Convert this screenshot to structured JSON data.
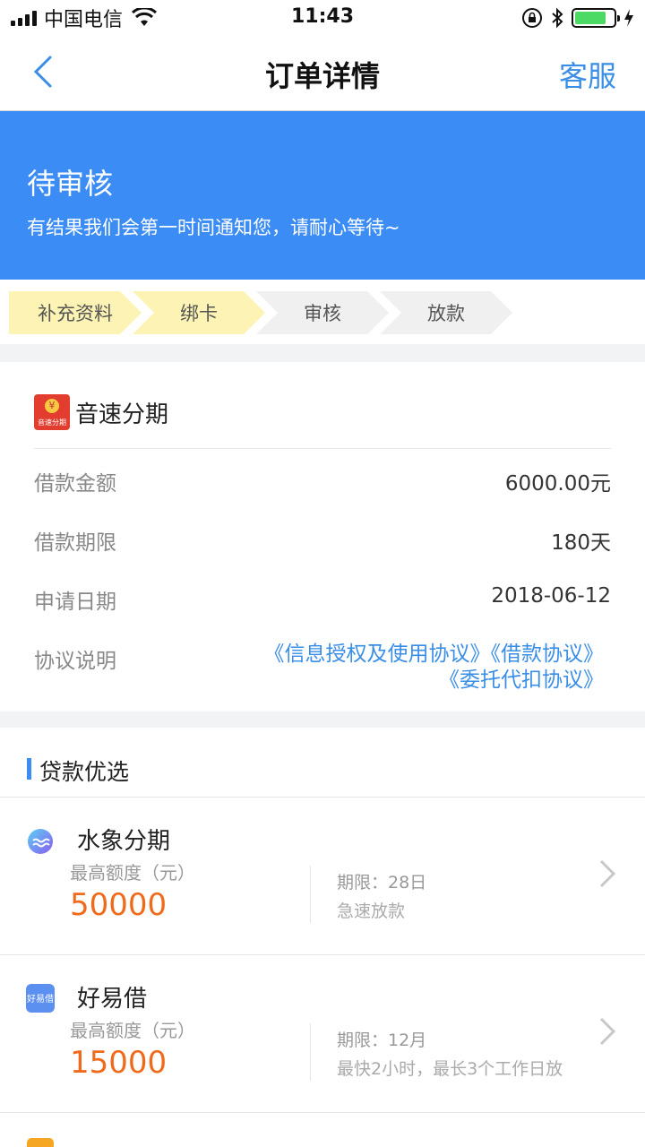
{
  "status_bar": {
    "carrier": "中国电信",
    "time": "11:43"
  },
  "nav": {
    "title": "订单详情",
    "service": "客服"
  },
  "banner": {
    "status": "待审核",
    "message": "有结果我们会第一时间通知您，请耐心等待~"
  },
  "steps": [
    {
      "label": "补充资料",
      "done": true
    },
    {
      "label": "绑卡",
      "done": true
    },
    {
      "label": "审核",
      "done": false
    },
    {
      "label": "放款",
      "done": false
    }
  ],
  "colors": {
    "accent": "#3b8cf5",
    "step_done": "#fdf3b4",
    "step_pending": "#f0f0f0",
    "amount": "#f06a1c"
  },
  "order": {
    "merchant": "音速分期",
    "merchant_logo_text": "音速分期",
    "rows": [
      {
        "label": "借款金额",
        "value": "6000.00元"
      },
      {
        "label": "借款期限",
        "value": "180天"
      },
      {
        "label": "申请日期",
        "value": "2018-06-12"
      }
    ],
    "agreement_label": "协议说明",
    "agreements_line1": "《信息授权及使用协议》《借款协议》",
    "agreements_line2": "《委托代扣协议》"
  },
  "recommend": {
    "title": "贷款优选",
    "products": [
      {
        "name": "水象分期",
        "limit_label": "最高额度（元）",
        "amount": "50000",
        "term": "期限：28日",
        "desc": "急速放款",
        "icon": "water-drop-icon"
      },
      {
        "name": "好易借",
        "limit_label": "最高额度（元）",
        "amount": "15000",
        "term": "期限：12月",
        "desc": "最快2小时，最长3个工作日放",
        "icon": "haoyijie-logo-icon",
        "icon_text": "好易借"
      }
    ]
  }
}
